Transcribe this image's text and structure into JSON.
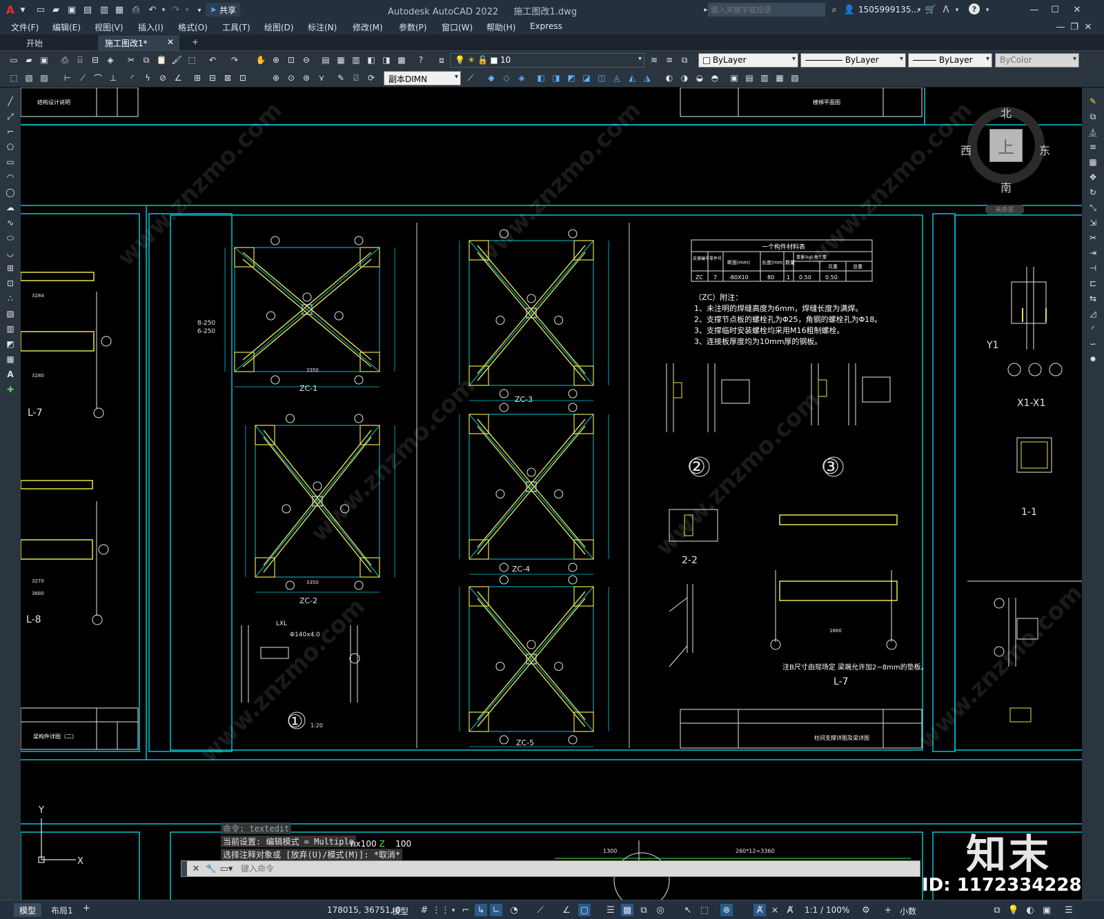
{
  "app": {
    "title": "Autodesk AutoCAD 2022",
    "file": "施工图改1.dwg",
    "search_placeholder": "键入关键字或短语",
    "user": "1505999135...",
    "share_label": "共享"
  },
  "menu": [
    "文件(F)",
    "编辑(E)",
    "视图(V)",
    "插入(I)",
    "格式(O)",
    "工具(T)",
    "绘图(D)",
    "标注(N)",
    "修改(M)",
    "参数(P)",
    "窗口(W)",
    "帮助(H)",
    "Express"
  ],
  "tabs": {
    "start": "开始",
    "current": "施工图改1*",
    "add": "+"
  },
  "toolbar": {
    "layer_value": "10",
    "dimstyle_value": "副本DIMN",
    "color_value": "ByLayer",
    "linetype_value": "ByLayer",
    "lineweight_value": "ByLayer",
    "plotstyle_value": "ByColor"
  },
  "viewcube": {
    "north": "北",
    "south": "南",
    "east": "东",
    "west": "西",
    "top": "上",
    "wcs": "未命名"
  },
  "drawing": {
    "sheet_left_title": "结构设计说明",
    "sheet_left_bottom_title": "梁构件详图（二）",
    "sheet_top_right_title": "楼梯平面图",
    "sheet_main_title": "柱间支撑详图及梁详图",
    "labels": {
      "zc1": "ZC-1",
      "zc2": "ZC-2",
      "zc3": "ZC-3",
      "zc4": "ZC-4",
      "zc5": "ZC-5",
      "l7": "L-7",
      "l8": "L-8",
      "l7b": "L-7",
      "s22": "2-2",
      "s11": "1-1",
      "x1x1": "X1-X1",
      "y1": "Y1",
      "c1": "①",
      "c2": "②",
      "c3": "③",
      "scale120": "1:20",
      "lxl": "LXL",
      "lxl2": "Φ140x4.0"
    },
    "material_table": {
      "title": "一个构件材料表",
      "headers": [
        "支撑编号",
        "零件号",
        "断面(mm)",
        "长度(mm)",
        "数量",
        "重量(kg) 每个重",
        "共重",
        "总重"
      ],
      "row": [
        "ZC",
        "7",
        "-80X10",
        "80",
        "1",
        "0.50",
        "0.50",
        ""
      ]
    },
    "notes": [
      "（ZC）附注：",
      "1、未注明的焊缝高度为6mm，焊缝长度为满焊。",
      "2、支撑节点板的螺栓孔为Φ25，角钢的螺栓孔为Φ18。",
      "3、支撑临时安装螺栓均采用M16粗制螺栓。",
      "3、连接板厚度均为10mm厚的钢板。"
    ],
    "note_l7": "注B尺寸由现场定 梁端允许加2~8mm的垫板。",
    "dim_labels": [
      "8-250",
      "6-250",
      "3350",
      "3350",
      "3280",
      "3284",
      "3270",
      "3680",
      "1660",
      "260*12=3360",
      "1300",
      "nx100",
      "100"
    ]
  },
  "command": {
    "line1": "命令:  textedit",
    "line2": "当前设置: 编辑模式 = Multiple",
    "line3": "选择注释对象或 [放弃(U)/模式(M)]: *取消*",
    "placeholder": "键入命令"
  },
  "status": {
    "model_tab": "模型",
    "layout_tab": "布局1",
    "add": "+",
    "coords": "178015, 36751, 0",
    "space": "模型",
    "scale": "1:1 / 100%",
    "units": "小数"
  },
  "watermark": {
    "brand": "知末",
    "id": "ID: 1172334228",
    "site": "www.znzmo.com"
  },
  "colors": {
    "cyan": "#00c7d6",
    "yellow": "#e8e24a",
    "white": "#ffffff",
    "bg": "#000000",
    "ui": "#2a3540"
  }
}
